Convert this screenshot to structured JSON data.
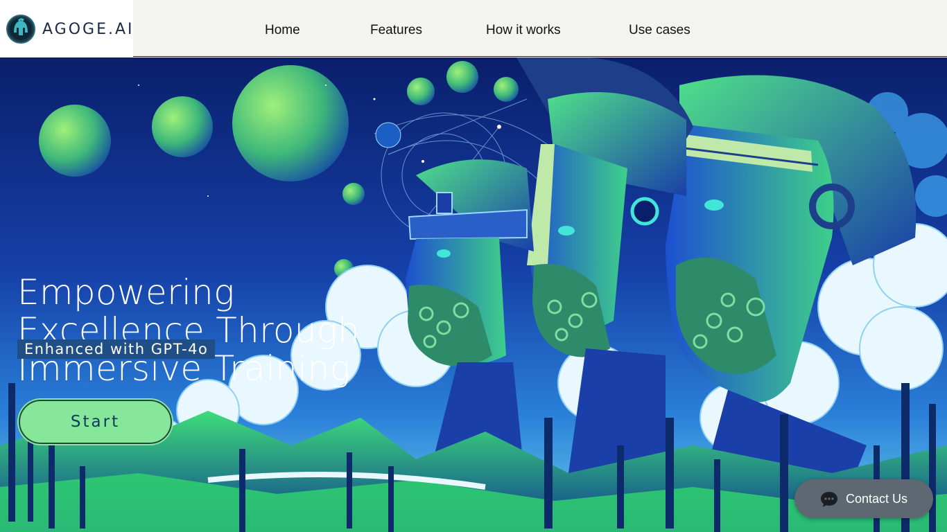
{
  "brand": {
    "name": "AGOGE.AI",
    "logo_icon": "spartan-helmet-icon"
  },
  "nav": {
    "items": [
      {
        "label": "Home"
      },
      {
        "label": "Features"
      },
      {
        "label": "How it works"
      },
      {
        "label": "Use cases"
      }
    ]
  },
  "hero": {
    "headline_lines": [
      "Empowering",
      "Excellence Through",
      "Immersive Training"
    ],
    "badge": "Enhanced with GPT-4o",
    "cta_label": "Start",
    "image": "spartan-warriors-illustration"
  },
  "contact": {
    "label": "Contact Us",
    "icon": "chat-bubble-icon"
  },
  "colors": {
    "header_bg": "#f3f3f2",
    "badge_bg": "#1f4f86",
    "cta_bg": "#86e69a",
    "cta_text": "#0e3b5c",
    "contact_bg": "#5d6872",
    "hero_deep_blue": "#0b2a7a",
    "hero_green": "#3fdc7a"
  }
}
